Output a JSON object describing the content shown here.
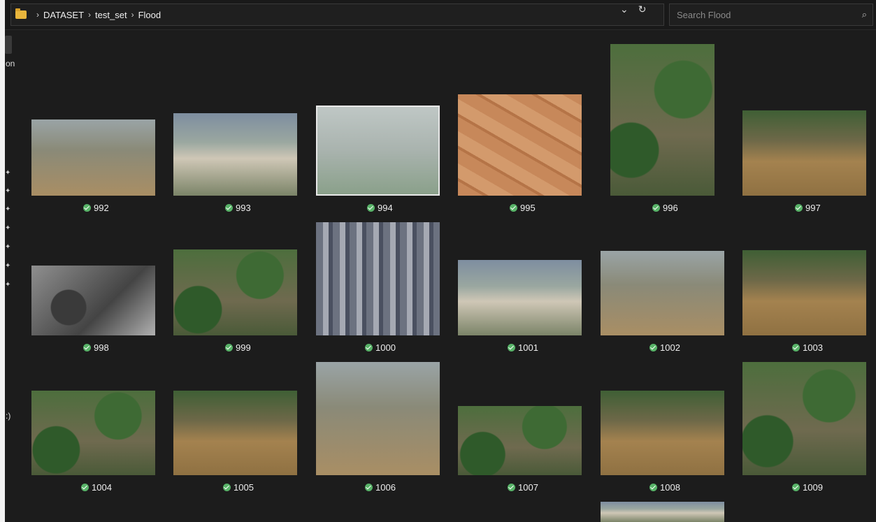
{
  "breadcrumb": {
    "segments": [
      "DATASET",
      "test_set",
      "Flood"
    ]
  },
  "address_tools": {
    "expand_icon": "chevron-down-icon",
    "refresh_icon": "refresh-icon"
  },
  "search": {
    "placeholder": "Search Flood"
  },
  "nav_pane": {
    "cut_label_top": "on",
    "cut_label_bottom": ":)"
  },
  "files": [
    {
      "name": "992",
      "status": "synced"
    },
    {
      "name": "993",
      "status": "synced"
    },
    {
      "name": "994",
      "status": "synced"
    },
    {
      "name": "995",
      "status": "synced"
    },
    {
      "name": "996",
      "status": "synced"
    },
    {
      "name": "997",
      "status": "synced"
    },
    {
      "name": "998",
      "status": "synced"
    },
    {
      "name": "999",
      "status": "synced"
    },
    {
      "name": "1000",
      "status": "synced"
    },
    {
      "name": "1001",
      "status": "synced"
    },
    {
      "name": "1002",
      "status": "synced"
    },
    {
      "name": "1003",
      "status": "synced"
    },
    {
      "name": "1004",
      "status": "synced"
    },
    {
      "name": "1005",
      "status": "synced"
    },
    {
      "name": "1006",
      "status": "synced"
    },
    {
      "name": "1007",
      "status": "synced"
    },
    {
      "name": "1008",
      "status": "synced"
    },
    {
      "name": "1009",
      "status": "synced"
    }
  ]
}
